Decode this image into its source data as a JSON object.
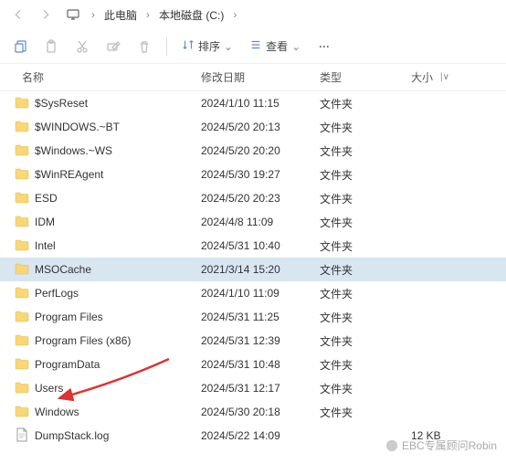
{
  "breadcrumb": {
    "items": [
      "此电脑",
      "本地磁盘 (C:)"
    ]
  },
  "toolbar": {
    "sort_label": "排序",
    "view_label": "查看"
  },
  "columns": {
    "name": "名称",
    "date": "修改日期",
    "type": "类型",
    "size": "大小"
  },
  "folder_type": "文件夹",
  "files": [
    {
      "name": "$SysReset",
      "date": "2024/1/10 11:15",
      "type": "文件夹",
      "icon": "folder"
    },
    {
      "name": "$WINDOWS.~BT",
      "date": "2024/5/20 20:13",
      "type": "文件夹",
      "icon": "folder"
    },
    {
      "name": "$Windows.~WS",
      "date": "2024/5/20 20:20",
      "type": "文件夹",
      "icon": "folder"
    },
    {
      "name": "$WinREAgent",
      "date": "2024/5/30 19:27",
      "type": "文件夹",
      "icon": "folder"
    },
    {
      "name": "ESD",
      "date": "2024/5/20 20:23",
      "type": "文件夹",
      "icon": "folder"
    },
    {
      "name": "IDM",
      "date": "2024/4/8 11:09",
      "type": "文件夹",
      "icon": "folder"
    },
    {
      "name": "Intel",
      "date": "2024/5/31 10:40",
      "type": "文件夹",
      "icon": "folder"
    },
    {
      "name": "MSOCache",
      "date": "2021/3/14 15:20",
      "type": "文件夹",
      "icon": "folder",
      "selected": true
    },
    {
      "name": "PerfLogs",
      "date": "2024/1/10 11:09",
      "type": "文件夹",
      "icon": "folder"
    },
    {
      "name": "Program Files",
      "date": "2024/5/31 11:25",
      "type": "文件夹",
      "icon": "folder"
    },
    {
      "name": "Program Files (x86)",
      "date": "2024/5/31 12:39",
      "type": "文件夹",
      "icon": "folder"
    },
    {
      "name": "ProgramData",
      "date": "2024/5/31 10:48",
      "type": "文件夹",
      "icon": "folder"
    },
    {
      "name": "Users",
      "date": "2024/5/31 12:17",
      "type": "文件夹",
      "icon": "folder"
    },
    {
      "name": "Windows",
      "date": "2024/5/30 20:18",
      "type": "文件夹",
      "icon": "folder"
    },
    {
      "name": "DumpStack.log",
      "date": "2024/5/22 14:09",
      "type": "",
      "icon": "file",
      "size": "12 KB"
    }
  ],
  "watermark": "EBC专属顾问Robin"
}
